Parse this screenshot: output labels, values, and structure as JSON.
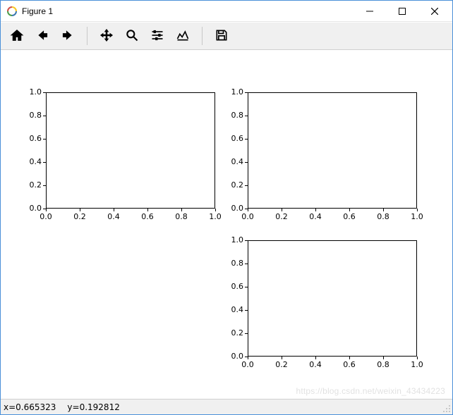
{
  "window": {
    "title": "Figure 1"
  },
  "toolbar": {
    "icons": {
      "home": "home-icon",
      "back": "back-icon",
      "forward": "forward-icon",
      "pan": "pan-icon",
      "zoom": "zoom-icon",
      "configure": "configure-icon",
      "edit": "edit-icon",
      "save": "save-icon"
    }
  },
  "chart_data": [
    {
      "type": "line",
      "position": "top-left",
      "x": [],
      "y": [],
      "xlim": [
        0.0,
        1.0
      ],
      "ylim": [
        0.0,
        1.0
      ],
      "xticks": [
        0.0,
        0.2,
        0.4,
        0.6,
        0.8,
        1.0
      ],
      "yticks": [
        0.0,
        0.2,
        0.4,
        0.6,
        0.8,
        1.0
      ],
      "title": "",
      "xlabel": "",
      "ylabel": ""
    },
    {
      "type": "line",
      "position": "top-right",
      "x": [],
      "y": [],
      "xlim": [
        0.0,
        1.0
      ],
      "ylim": [
        0.0,
        1.0
      ],
      "xticks": [
        0.0,
        0.2,
        0.4,
        0.6,
        0.8,
        1.0
      ],
      "yticks": [
        0.0,
        0.2,
        0.4,
        0.6,
        0.8,
        1.0
      ],
      "title": "",
      "xlabel": "",
      "ylabel": ""
    },
    {
      "type": "line",
      "position": "bottom-right",
      "x": [],
      "y": [],
      "xlim": [
        0.0,
        1.0
      ],
      "ylim": [
        0.0,
        1.0
      ],
      "xticks": [
        0.0,
        0.2,
        0.4,
        0.6,
        0.8,
        1.0
      ],
      "yticks": [
        0.0,
        0.2,
        0.4,
        0.6,
        0.8,
        1.0
      ],
      "title": "",
      "xlabel": "",
      "ylabel": ""
    }
  ],
  "status": {
    "x_label": "x=0.665323",
    "y_label": "y=0.192812"
  },
  "watermark": "https://blog.csdn.net/weixin_43434223"
}
